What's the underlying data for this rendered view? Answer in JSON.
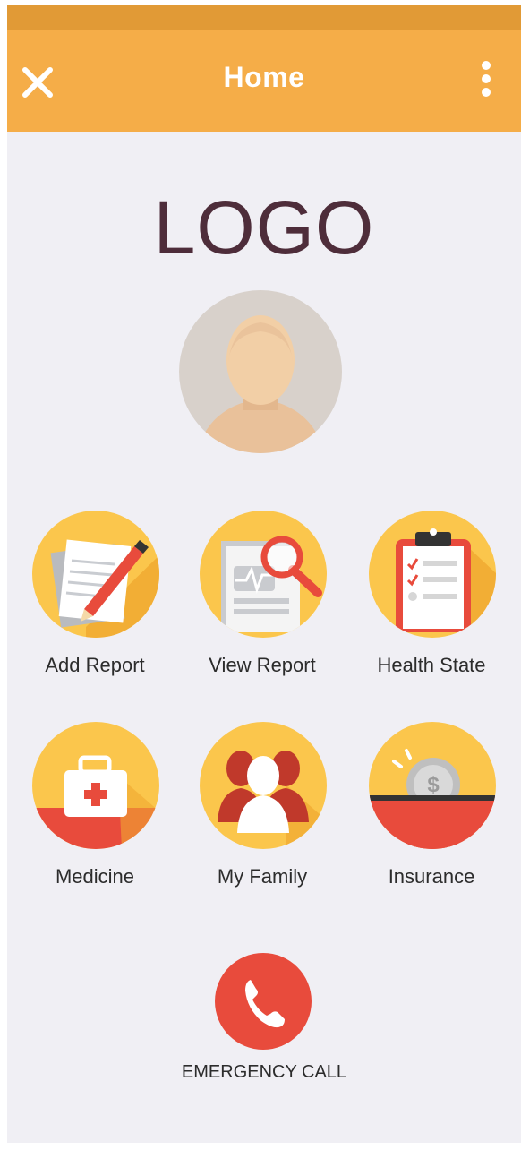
{
  "header": {
    "title": "Home",
    "close_icon": "close-icon",
    "menu_icon": "more-vertical-icon",
    "color": "#f5ad48",
    "status_color": "#e19a36"
  },
  "logo": {
    "text": "LOGO",
    "color": "#4e2d3a"
  },
  "profile": {
    "avatar_icon": "user-avatar-icon"
  },
  "tiles": [
    {
      "label": "Add Report",
      "icon": "add-report-icon"
    },
    {
      "label": "View Report",
      "icon": "view-report-icon"
    },
    {
      "label": "Health State",
      "icon": "health-state-icon"
    },
    {
      "label": "Medicine",
      "icon": "medicine-icon"
    },
    {
      "label": "My Family",
      "icon": "family-icon"
    },
    {
      "label": "Insurance",
      "icon": "insurance-icon"
    }
  ],
  "emergency": {
    "label": "EMERGENCY CALL",
    "icon": "phone-icon",
    "color": "#e84b3c"
  },
  "colors": {
    "tile_bg": "#fbc64c",
    "accent_red": "#e84b3c",
    "screen_bg": "#f0eff4"
  }
}
